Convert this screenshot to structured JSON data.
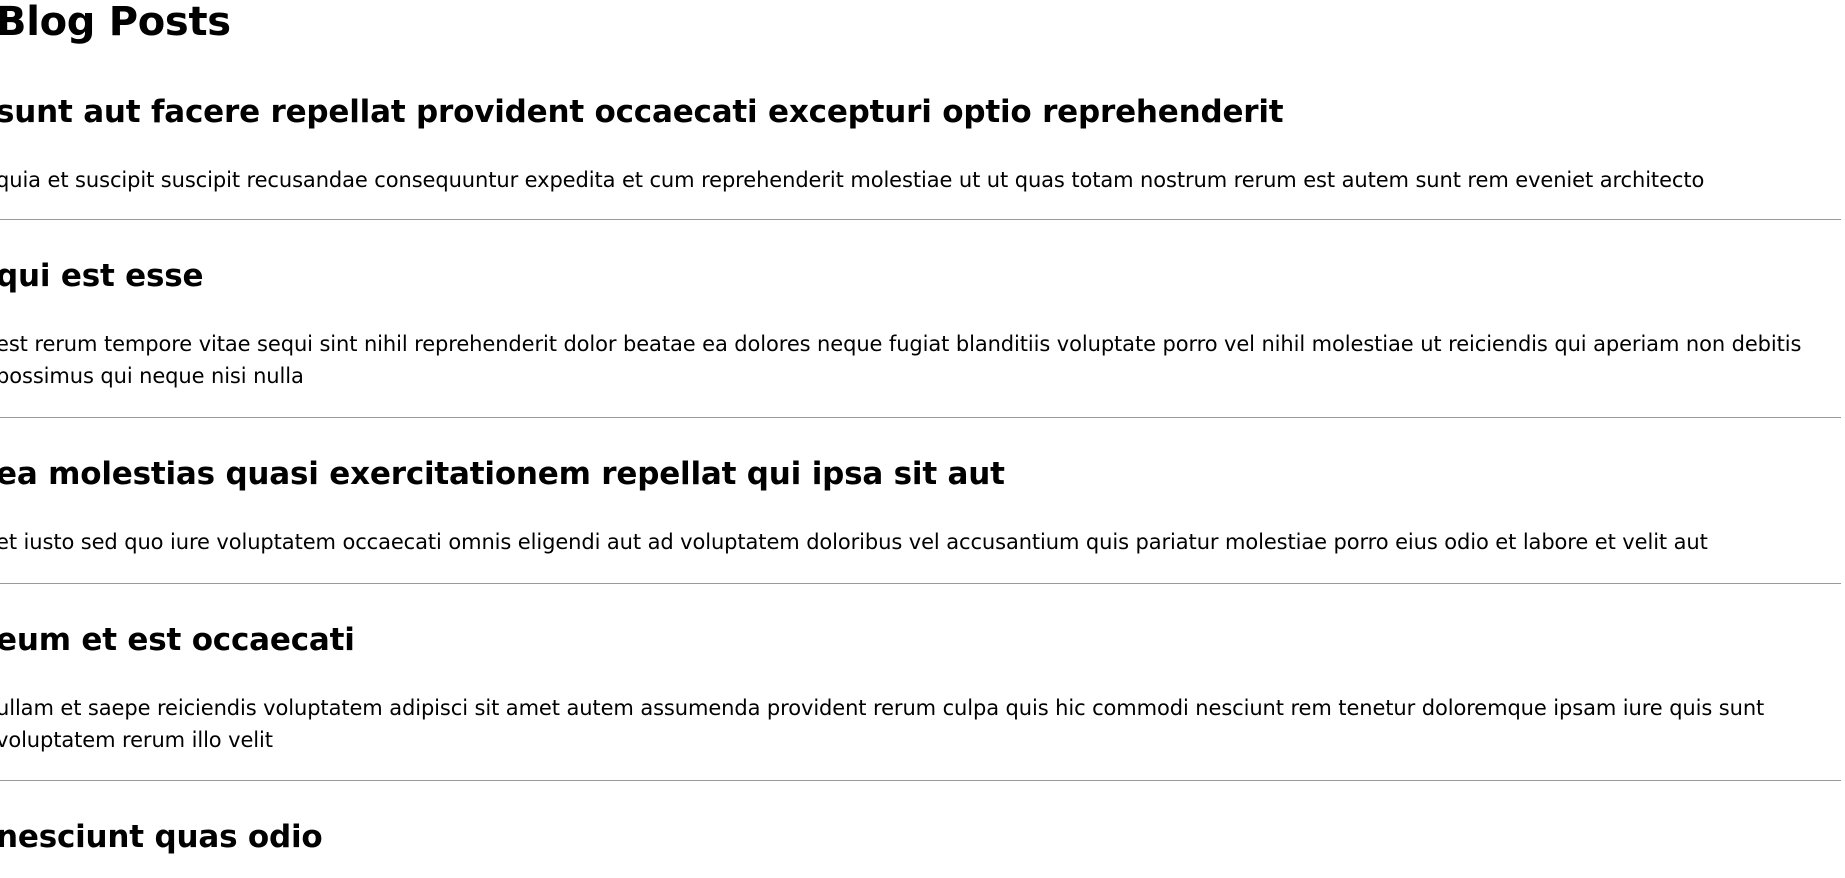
{
  "page": {
    "title": "Blog Posts"
  },
  "posts": [
    {
      "title": "sunt aut facere repellat provident occaecati excepturi optio reprehenderit",
      "body": "quia et suscipit suscipit recusandae consequuntur expedita et cum reprehenderit molestiae ut ut quas totam nostrum rerum est autem sunt rem eveniet architecto"
    },
    {
      "title": "qui est esse",
      "body": "est rerum tempore vitae sequi sint nihil reprehenderit dolor beatae ea dolores neque fugiat blanditiis voluptate porro vel nihil molestiae ut reiciendis qui aperiam non debitis possimus qui neque nisi nulla"
    },
    {
      "title": "ea molestias quasi exercitationem repellat qui ipsa sit aut",
      "body": "et iusto sed quo iure voluptatem occaecati omnis eligendi aut ad voluptatem doloribus vel accusantium quis pariatur molestiae porro eius odio et labore et velit aut"
    },
    {
      "title": "eum et est occaecati",
      "body": "ullam et saepe reiciendis voluptatem adipisci sit amet autem assumenda provident rerum culpa quis hic commodi nesciunt rem tenetur doloremque ipsam iure quis sunt voluptatem rerum illo velit"
    },
    {
      "title": "nesciunt quas odio"
    }
  ]
}
